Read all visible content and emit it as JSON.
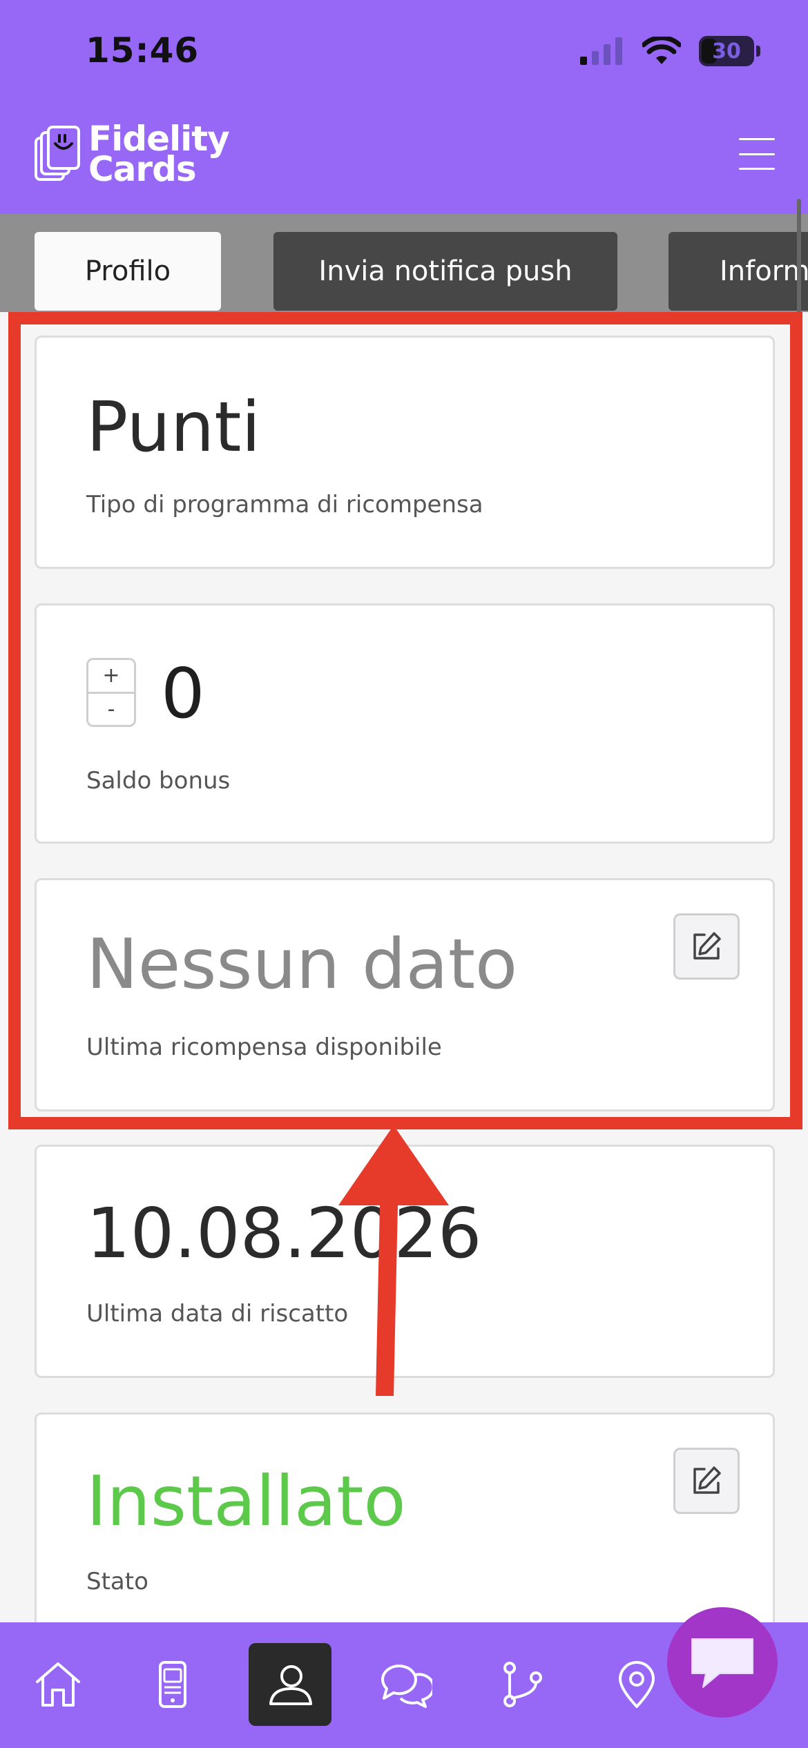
{
  "status_bar": {
    "time": "15:46",
    "battery": "30"
  },
  "header": {
    "logo_line1": "Fidelity",
    "logo_line2": "Cards"
  },
  "tabs": [
    {
      "label": "Profilo",
      "active": true
    },
    {
      "label": "Invia notifica push",
      "active": false
    },
    {
      "label": "Informa",
      "active": false
    }
  ],
  "cards": {
    "reward_type": {
      "value": "Punti",
      "label": "Tipo di programma di ricompensa"
    },
    "bonus_balance": {
      "value": "0",
      "label": "Saldo bonus",
      "stepper_plus": "+",
      "stepper_minus": "-"
    },
    "last_reward": {
      "value": "Nessun dato",
      "label": "Ultima ricompensa disponibile"
    },
    "last_redeem": {
      "value": "10.08.2026",
      "label": "Ultima data di riscatto"
    },
    "status": {
      "value": "Installato",
      "label": "Stato"
    }
  },
  "colors": {
    "brand_purple": "#9768F6",
    "highlight_red": "#E63A2A",
    "status_green": "#5CC94B",
    "muted_text": "#8a8a8a",
    "chat_fab": "#A136C9"
  },
  "bottom_nav": [
    {
      "icon": "home-icon",
      "active": false
    },
    {
      "icon": "mobile-card-icon",
      "active": false
    },
    {
      "icon": "user-profile-icon",
      "active": true
    },
    {
      "icon": "chat-bubbles-icon",
      "active": false
    },
    {
      "icon": "branches-icon",
      "active": false
    },
    {
      "icon": "location-pin-icon",
      "active": false
    }
  ]
}
